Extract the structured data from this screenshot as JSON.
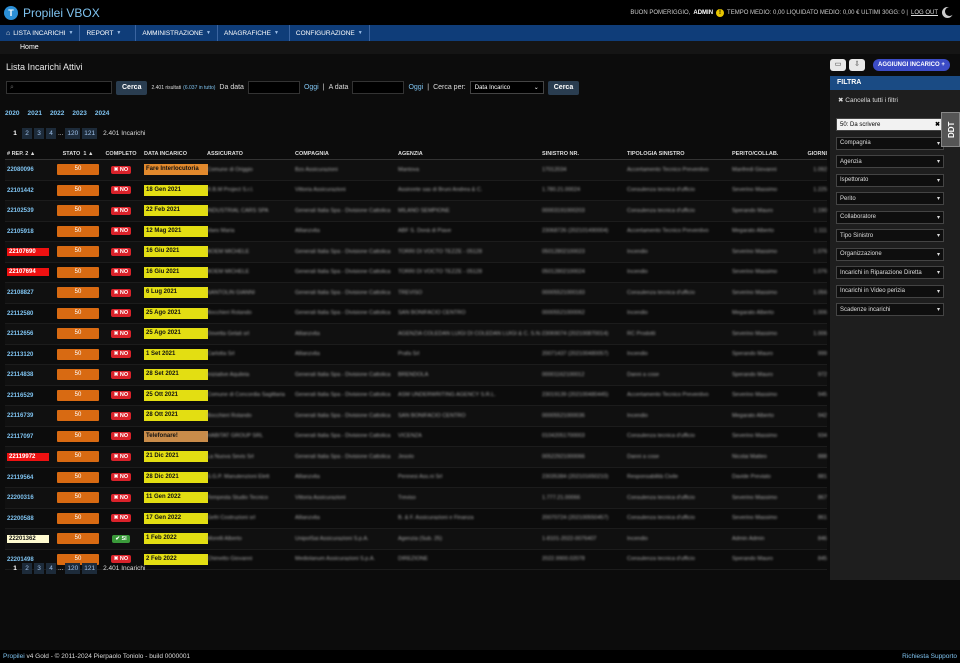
{
  "app": {
    "title": "Propilei VBOX"
  },
  "header": {
    "greeting": "BUON POMERIGGIO,",
    "user": "ADMIN",
    "warn": "!",
    "stats": "TEMPO MEDIO: 0,00 LIQUIDATO MEDIO: 0,00 € ULTIMI 30GG: 0 |",
    "logout": "LOG OUT"
  },
  "nav": [
    {
      "label": "LISTA INCARICHI"
    },
    {
      "label": "REPORT"
    },
    {
      "label": "AMMINISTRAZIONE"
    },
    {
      "label": "ANAGRAFICHE"
    },
    {
      "label": "CONFIGURAZIONE"
    }
  ],
  "breadcrumb": "Home",
  "page": {
    "title": "Lista Incarichi Attivi"
  },
  "search": {
    "button": "Cerca",
    "results": "2.401 risultati",
    "results_total": "(6.037 in tutto)",
    "date_from": "Da data",
    "today1": "Oggi",
    "date_to": "A data",
    "today2": "Oggi",
    "search_by": "Cerca per:",
    "search_by_value": "Data Incarico",
    "button2": "Cerca"
  },
  "years": [
    "2020",
    "2021",
    "2022",
    "2023",
    "2024"
  ],
  "pager": {
    "pages": [
      "1",
      "2",
      "3",
      "4",
      "...",
      "120",
      "121"
    ],
    "total": "2.401 Incarichi"
  },
  "columns": [
    "# REP.",
    "2 ▲",
    "STATO",
    "1 ▲",
    "COMPLETO",
    "DATA INCARICO",
    "ASSICURATO",
    "COMPAGNIA",
    "AGENZIA",
    "SINISTRO NR.",
    "TIPOLOGIA SINISTRO",
    "PERITO/COLLAB.",
    "GIORNI"
  ],
  "rows": [
    {
      "rep": "22080096",
      "rep_style": "normal",
      "stato": "50",
      "completo": "✖ NO",
      "date": "Fare Interlocutoria",
      "date_style": "orange",
      "assicurato": "Comune di Origgio",
      "compagnia": "Bzs Assicurazioni",
      "agenzia": "Mantova",
      "sinistro": "17012034",
      "tipologia": "Accertamento Tecnico Preventivo",
      "perito": "Manfredi Giovanni",
      "giorni": "1.092"
    },
    {
      "rep": "22101442",
      "rep_style": "normal",
      "stato": "50",
      "completo": "✖ NO",
      "date": "18 Gen 2021",
      "date_style": "yellow",
      "assicurato": "R.B.M Project S.r.l.",
      "compagnia": "Vittoria Assicurazioni",
      "agenzia": "Assinrete sas di Bruni Andrea & C.",
      "sinistro": "1.780.21.00024",
      "tipologia": "Consulenza tecnica d'ufficio",
      "perito": "Severino Massimo",
      "giorni": "1.225"
    },
    {
      "rep": "22102539",
      "rep_style": "normal",
      "stato": "50",
      "completo": "✖ NO",
      "date": "22 Feb 2021",
      "date_style": "yellow",
      "assicurato": "INDUSTRIAL CARS SPA",
      "compagnia": "Generali Italia Spa - Divisione Cattolica",
      "agenzia": "MILANO SEMPIONE",
      "sinistro": "00003191000203",
      "tipologia": "Consulenza tecnica d'ufficio",
      "perito": "Sperando Mauro",
      "giorni": "1.190"
    },
    {
      "rep": "22105918",
      "rep_style": "normal",
      "stato": "50",
      "completo": "✖ NO",
      "date": "12 Mag 2021",
      "date_style": "yellow",
      "assicurato": "Vaes Maria",
      "compagnia": "Allianzvita",
      "agenzia": "ABF S. Donà di Piave",
      "sinistro": "23068726 (202101490004)",
      "tipologia": "Accertamento Tecnico Preventivo",
      "perito": "Megarato Alberto",
      "giorni": "1.111"
    },
    {
      "rep": "22107690",
      "rep_style": "red",
      "stato": "50",
      "completo": "✖ NO",
      "date": "16 Giu 2021",
      "date_style": "yellow",
      "assicurato": "BOEM MICHELE",
      "compagnia": "Generali Italia Spa - Divisione Cattolica",
      "agenzia": "TORRI DI VOCTO TEZZE - 05128",
      "sinistro": "05012802100023",
      "tipologia": "Incendio",
      "perito": "Severino Massimo",
      "giorni": "1.076"
    },
    {
      "rep": "22107694",
      "rep_style": "red",
      "stato": "50",
      "completo": "✖ NO",
      "date": "16 Giu 2021",
      "date_style": "yellow",
      "assicurato": "BOEM MICHELE",
      "compagnia": "Generali Italia Spa - Divisione Cattolica",
      "agenzia": "TORRI DI VOCTO TEZZE - 05128",
      "sinistro": "05012802100024",
      "tipologia": "Incendio",
      "perito": "Severino Massimo",
      "giorni": "1.076"
    },
    {
      "rep": "22108827",
      "rep_style": "normal",
      "stato": "50",
      "completo": "✖ NO",
      "date": "6 Lug 2021",
      "date_style": "yellow",
      "assicurato": "SANTOLIN GIANNI",
      "compagnia": "Generali Italia Spa - Divisione Cattolica",
      "agenzia": "TREVISO",
      "sinistro": "00005521000183",
      "tipologia": "Consulenza tecnica d'ufficio",
      "perito": "Severino Massimo",
      "giorni": "1.056"
    },
    {
      "rep": "22112580",
      "rep_style": "normal",
      "stato": "50",
      "completo": "✖ NO",
      "date": "25 Ago 2021",
      "date_style": "yellow",
      "assicurato": "Bocchieri Rolando",
      "compagnia": "Generali Italia Spa - Divisione Cattolica",
      "agenzia": "SAN BONIFACIO CENTRO",
      "sinistro": "00005521000062",
      "tipologia": "Incendio",
      "perito": "Megarato Alberto",
      "giorni": "1.006"
    },
    {
      "rep": "22112656",
      "rep_style": "normal",
      "stato": "50",
      "completo": "✖ NO",
      "date": "25 Ago 2021",
      "date_style": "yellow",
      "assicurato": "Dovetta Gelati srl",
      "compagnia": "Allianzvita",
      "agenzia": "AGENZIA COLEDAN LUIGI DI COLEDAN LUIGI & C. S.N.C.",
      "sinistro": "23069074 (202100870014)",
      "tipologia": "RC Prodotti",
      "perito": "Severino Massimo",
      "giorni": "1.006"
    },
    {
      "rep": "22113120",
      "rep_style": "normal",
      "stato": "50",
      "completo": "✖ NO",
      "date": "1 Set 2021",
      "date_style": "yellow",
      "assicurato": "Carlotta Srl",
      "compagnia": "Allianzvita",
      "agenzia": "Prafa Srl",
      "sinistro": "20071437 (202100480057)",
      "tipologia": "Incendio",
      "perito": "Sperando Mauro",
      "giorni": "999"
    },
    {
      "rep": "22114838",
      "rep_style": "normal",
      "stato": "50",
      "completo": "✖ NO",
      "date": "28 Set 2021",
      "date_style": "yellow",
      "assicurato": "Iniziative Aquileia",
      "compagnia": "Generali Italia Spa - Divisione Cattolica",
      "agenzia": "BRENDOLA",
      "sinistro": "00001162100012",
      "tipologia": "Danni a cose",
      "perito": "Sperando Mauro",
      "giorni": "972"
    },
    {
      "rep": "22116529",
      "rep_style": "normal",
      "stato": "50",
      "completo": "✖ NO",
      "date": "25 Ott 2021",
      "date_style": "yellow",
      "assicurato": "Comune di Concordia Sagittaria",
      "compagnia": "Generali Italia Spa - Divisione Cattolica",
      "agenzia": "ASM UNDERWRITING AGENCY S.R.L.",
      "sinistro": "23019139 (202100480445)",
      "tipologia": "Accertamento Tecnico Preventivo",
      "perito": "Severino Massimo",
      "giorni": "945"
    },
    {
      "rep": "22116739",
      "rep_style": "normal",
      "stato": "50",
      "completo": "✖ NO",
      "date": "28 Ott 2021",
      "date_style": "yellow",
      "assicurato": "Bocchieri Rolando",
      "compagnia": "Generali Italia Spa - Divisione Cattolica",
      "agenzia": "SAN BONIFACIO CENTRO",
      "sinistro": "00005521000036",
      "tipologia": "Incendio",
      "perito": "Megarato Alberto",
      "giorni": "942"
    },
    {
      "rep": "22117097",
      "rep_style": "normal",
      "stato": "50",
      "completo": "✖ NO",
      "date": "Telefonare!",
      "date_style": "tan",
      "assicurato": "HABITAT GROUP SRL",
      "compagnia": "Generali Italia Spa - Divisione Cattolica",
      "agenzia": "VICENZA",
      "sinistro": "01042051700003",
      "tipologia": "Consulenza tecnica d'ufficio",
      "perito": "Severino Massimo",
      "giorni": "934"
    },
    {
      "rep": "22119972",
      "rep_style": "red",
      "stato": "50",
      "completo": "✖ NO",
      "date": "21 Dic 2021",
      "date_style": "yellow",
      "assicurato": "La Nuova Sevis Srl",
      "compagnia": "Generali Italia Spa - Divisione Cattolica",
      "agenzia": "Jesolo",
      "sinistro": "00522921000066",
      "tipologia": "Danni a cose",
      "perito": "Nicolai Matteo",
      "giorni": "888"
    },
    {
      "rep": "22119564",
      "rep_style": "normal",
      "stato": "50",
      "completo": "✖ NO",
      "date": "28 Dic 2021",
      "date_style": "yellow",
      "assicurato": "S.G.P. Manutenzioni Elett",
      "compagnia": "Allianzvita",
      "agenzia": "Pennesi Ass.ni Srl",
      "sinistro": "23035384 (202101650210)",
      "tipologia": "Responsabilità Civile",
      "perito": "Davide Previato",
      "giorni": "881"
    },
    {
      "rep": "22200316",
      "rep_style": "normal",
      "stato": "50",
      "completo": "✖ NO",
      "date": "11 Gen 2022",
      "date_style": "yellow",
      "assicurato": "Tempesta Studio Tecnico",
      "compagnia": "Vittoria Assicurazioni",
      "agenzia": "Treviso",
      "sinistro": "1.777.21.00066",
      "tipologia": "Consulenza tecnica d'ufficio",
      "perito": "Severino Massimo",
      "giorni": "867"
    },
    {
      "rep": "22200588",
      "rep_style": "normal",
      "stato": "50",
      "completo": "✖ NO",
      "date": "17 Gen 2022",
      "date_style": "yellow",
      "assicurato": "Gefri Costruzioni srl",
      "compagnia": "Allianzvita",
      "agenzia": "B. & F. Assicurazioni e Finanza",
      "sinistro": "20070724 (202100550457)",
      "tipologia": "Consulenza tecnica d'ufficio",
      "perito": "Severino Massimo",
      "giorni": "861"
    },
    {
      "rep": "22201362",
      "rep_style": "yellow",
      "stato": "50",
      "completo": "✔ SI",
      "date": "1 Feb 2022",
      "date_style": "yellow",
      "assicurato": "Morelli Alberto",
      "compagnia": "UnipolSai Assicurazioni S.p.A.",
      "agenzia": "Agenzia (Sub. 25)",
      "sinistro": "1-8101-2022-0076407",
      "tipologia": "Incendio",
      "perito": "Admin Admin",
      "giorni": "846"
    },
    {
      "rep": "22201498",
      "rep_style": "normal",
      "stato": "50",
      "completo": "✖ NO",
      "date": "2 Feb 2022",
      "date_style": "yellow",
      "assicurato": "Chimetto Giovanni",
      "compagnia": "Mediolanum Assicurazioni S.p.A.",
      "agenzia": "DIREZIONE",
      "sinistro": "2022.9900.02078",
      "tipologia": "Consulenza tecnica d'ufficio",
      "perito": "Sperando Mauro",
      "giorni": "845"
    }
  ],
  "filter": {
    "title": "FILTRA",
    "clear": "✖ Cancella tutti i filtri",
    "selects": [
      "50: Da scrivere",
      "Compagnia",
      "Agenzia",
      "Ispettorato",
      "Perito",
      "Collaboratore",
      "Tipo Sinistro",
      "Organizzazione",
      "Incarichi in Riparazione Diretta",
      "Incarichi in Video perizia",
      "Scadenze incarichi"
    ]
  },
  "ddt": "DDT",
  "actions": {
    "add": "AGGIUNGI INCARICO +"
  },
  "footer": {
    "brand": "Propilei",
    "left": " v4 Gold - © 2011-2024 Pierpaolo Toniolo - build 0000001",
    "right": "Richiesta Supporto"
  }
}
